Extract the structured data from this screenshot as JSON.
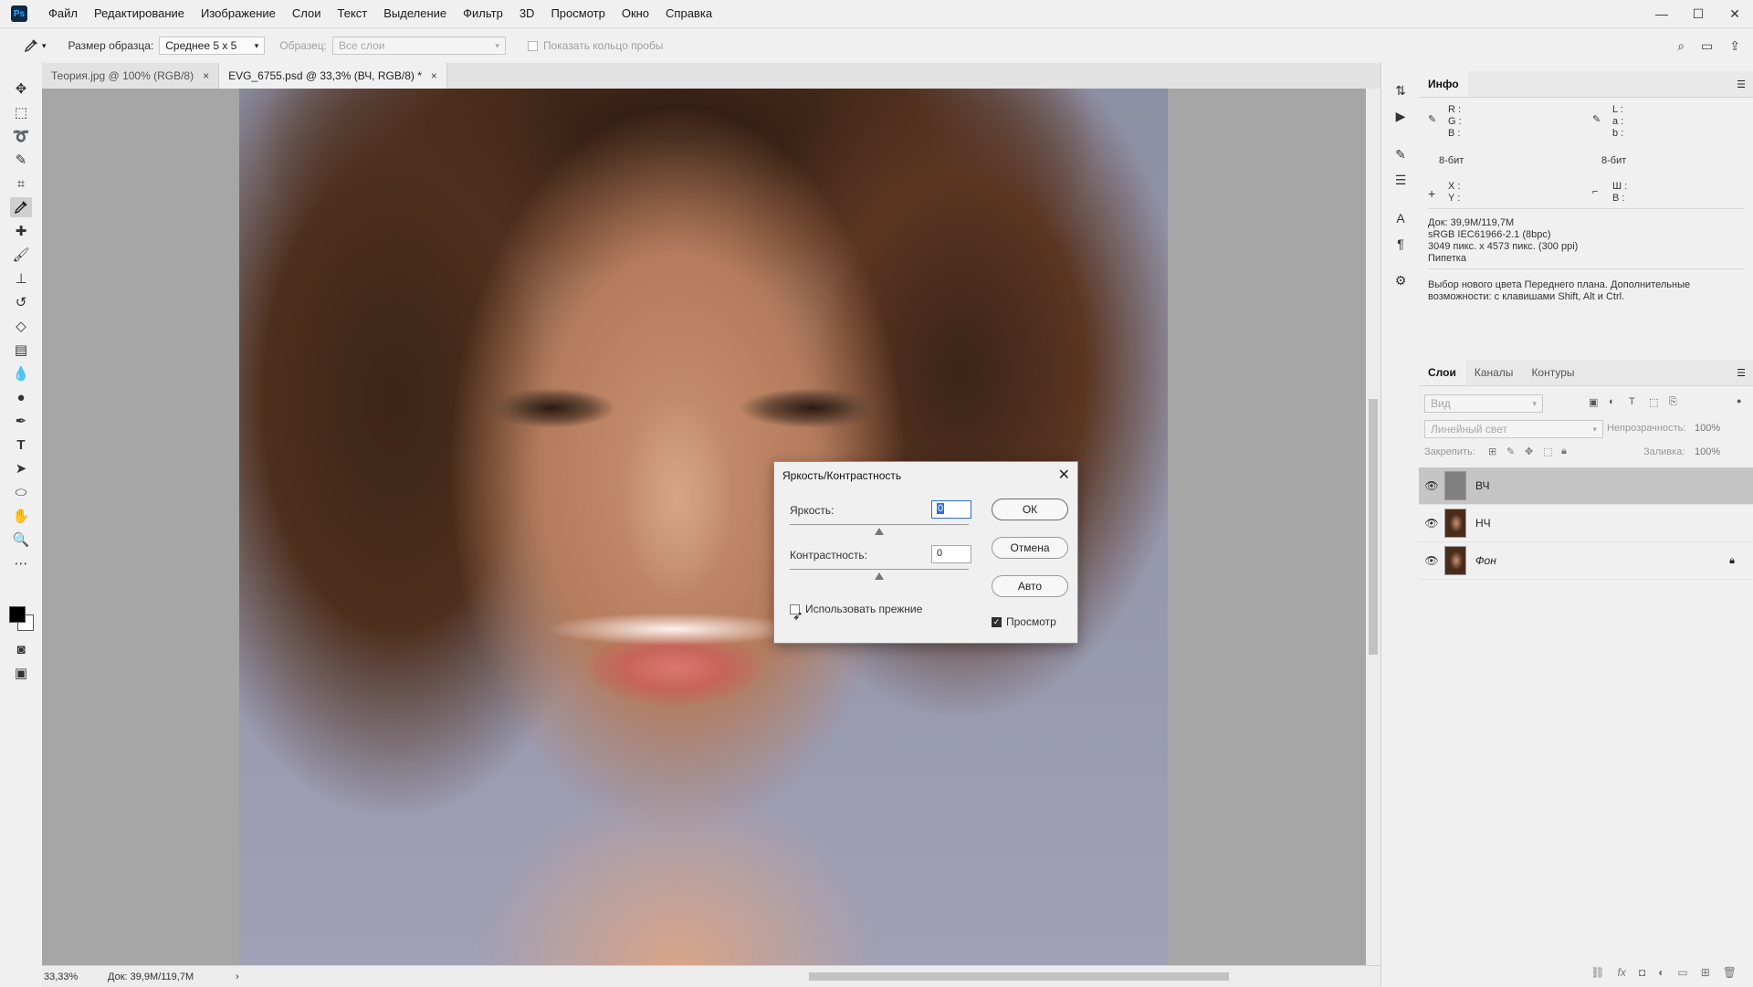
{
  "app": {
    "logo": "Ps"
  },
  "menubar": {
    "items": [
      "Файл",
      "Редактирование",
      "Изображение",
      "Слои",
      "Текст",
      "Выделение",
      "Фильтр",
      "3D",
      "Просмотр",
      "Окно",
      "Справка"
    ]
  },
  "window_controls": {
    "minimize": "—",
    "maximize": "☐",
    "close": "✕"
  },
  "options_bar": {
    "sample_size_label": "Размер образца:",
    "sample_size_value": "Среднее 5 х 5",
    "samples_label": "Образец:",
    "samples_value": "Все слои",
    "show_ring_label": "Показать кольцо пробы"
  },
  "tabs": [
    {
      "label": "Теория.jpg @ 100% (RGB/8)",
      "close": "×"
    },
    {
      "label": "EVG_6755.psd @ 33,3% (ВЧ, RGB/8) *",
      "close": "×"
    }
  ],
  "status_bar": {
    "zoom": "33,33%",
    "doc": "Док: 39,9М/119,7М",
    "arrow": "›"
  },
  "info_panel": {
    "tab": "Инфо",
    "rgb_labels": [
      "R :",
      "G :",
      "B :"
    ],
    "lab_labels": [
      "L :",
      "a :",
      "b :"
    ],
    "bit_left": "8-бит",
    "bit_right": "8-бит",
    "xy_labels": [
      "X :",
      "Y :"
    ],
    "wh_labels": [
      "Ш :",
      "В :"
    ],
    "doc_line": "Док: 39,9М/119,7М",
    "profile_line": "sRGB IEC61966-2.1 (8bpc)",
    "size_line": "3049 пикс. x 4573 пикс. (300 ppi)",
    "tool_line": "Пипетка",
    "hint_line1": "Выбор нового цвета Переднего плана. Дополнительные",
    "hint_line2": "возможности: с клавишами Shift, Alt и Ctrl."
  },
  "layers_panel": {
    "tabs": [
      "Слои",
      "Каналы",
      "Контуры"
    ],
    "filter_placeholder": "Вид",
    "blend_mode": "Линейный свет",
    "opacity_label": "Непрозрачность:",
    "opacity_value": "100%",
    "lock_label": "Закрепить:",
    "fill_label": "Заливка:",
    "fill_value": "100%",
    "layers": [
      {
        "name": "ВЧ",
        "selected": true,
        "locked": false
      },
      {
        "name": "НЧ",
        "selected": false,
        "locked": false
      },
      {
        "name": "Фон",
        "selected": false,
        "locked": true
      }
    ]
  },
  "dialog": {
    "title": "Яркость/Контрастность",
    "brightness_label": "Яркость:",
    "brightness_value": "0",
    "contrast_label": "Контрастность:",
    "contrast_value": "0",
    "use_legacy_label": "Использовать прежние",
    "preview_label": "Просмотр",
    "ok_label": "ОК",
    "cancel_label": "Отмена",
    "auto_label": "Авто",
    "use_legacy_checked": false,
    "preview_checked": true
  },
  "colors": {
    "foreground": "#000000",
    "background": "#ffffff",
    "selected_layer": "#c5c5c5",
    "focus_accent": "#2b6ed8"
  }
}
